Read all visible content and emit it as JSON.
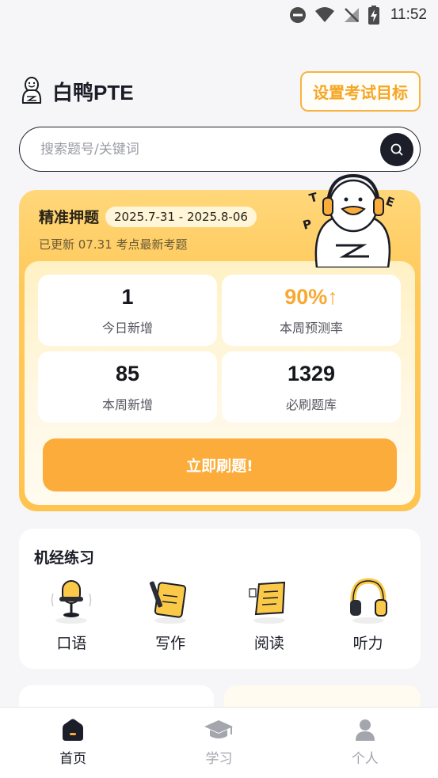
{
  "status_bar": {
    "time": "11:52"
  },
  "header": {
    "brand": "白鸭PTE",
    "goal_button": "设置考试目标"
  },
  "search": {
    "placeholder": "搜索题号/关键词"
  },
  "hot": {
    "title": "精准押题",
    "date_range": "2025.7-31 - 2025.8-06",
    "subtitle": "已更新 07.31 考点最新考题",
    "stats": [
      {
        "value": "1",
        "label": "今日新增"
      },
      {
        "value": "90%↑",
        "label": "本周预测率"
      },
      {
        "value": "85",
        "label": "本周新增"
      },
      {
        "value": "1329",
        "label": "必刷题库"
      }
    ],
    "button": "立即刷题!",
    "accent_color": "#f8a933",
    "mascot_letters": [
      "T",
      "P",
      "E"
    ]
  },
  "practice": {
    "title": "机经练习",
    "items": [
      {
        "label": "口语",
        "icon": "microphone-icon"
      },
      {
        "label": "写作",
        "icon": "notepad-pencil-icon"
      },
      {
        "label": "阅读",
        "icon": "reading-paper-icon"
      },
      {
        "label": "听力",
        "icon": "headphones-icon"
      }
    ]
  },
  "tabbar": {
    "tabs": [
      {
        "label": "首页",
        "icon": "home-icon",
        "active": true
      },
      {
        "label": "学习",
        "icon": "graduation-cap-icon",
        "active": false
      },
      {
        "label": "个人",
        "icon": "person-icon",
        "active": false
      }
    ]
  }
}
